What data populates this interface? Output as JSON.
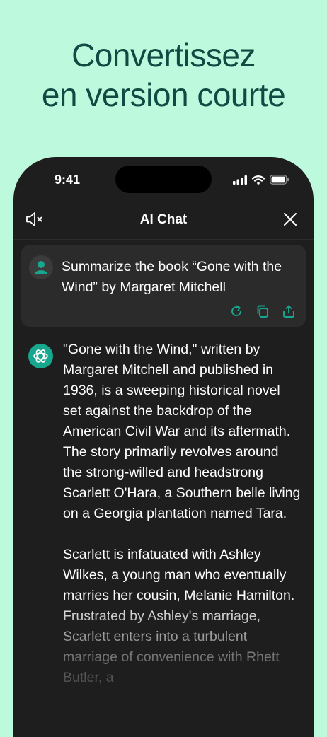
{
  "headline": {
    "line1": "Convertissez",
    "line2": "en version courte"
  },
  "status_bar": {
    "time": "9:41"
  },
  "nav": {
    "title": "AI Chat"
  },
  "user_message": {
    "text": "Summarize the book “Gone with the Wind” by Margaret Mitchell"
  },
  "bot_message": {
    "paragraph1": "\"Gone with the Wind,\" written by Margaret Mitchell and published in 1936, is a sweeping historical novel set against the backdrop of the American Civil War and its aftermath. The story primarily revolves around the strong-willed and headstrong Scarlett O'Hara, a Southern belle living on a Georgia plantation named Tara.",
    "paragraph2": "Scarlett is infatuated with Ashley Wilkes, a young man who eventually marries her cousin, Melanie Hamilton. Frustrated by Ashley's marriage, Scarlett enters into a turbulent marriage of convenience with Rhett Butler, a"
  },
  "icons": {
    "mute": "speaker-muted-icon",
    "close": "close-icon",
    "regenerate": "refresh-icon",
    "copy": "copy-icon",
    "share": "share-icon",
    "user_avatar": "user-icon",
    "bot_avatar": "openai-logo-icon"
  },
  "colors": {
    "background": "#bdf9dd",
    "headline": "#0f4a43",
    "accent": "#17a68e",
    "phone_bg": "#1e1e1e",
    "card_bg": "#2b2b2b"
  }
}
